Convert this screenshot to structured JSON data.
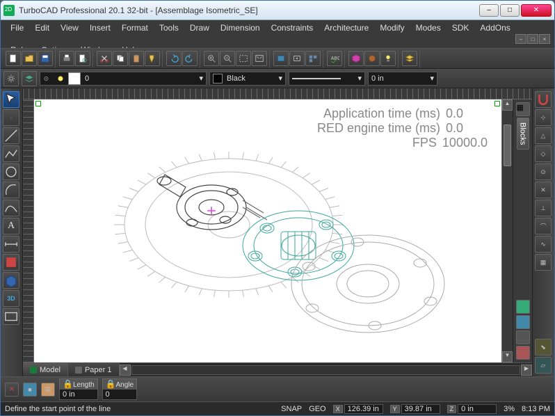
{
  "title": "TurboCAD Professional 20.1 32-bit - [Assemblage Isometric_SE]",
  "menus": [
    "File",
    "Edit",
    "View",
    "Insert",
    "Format",
    "Tools",
    "Draw",
    "Dimension",
    "Constraints",
    "Architecture",
    "Modify",
    "Modes",
    "SDK",
    "AddOns",
    "Ruby",
    "Options",
    "Window",
    "Help"
  ],
  "layer": {
    "value": "0"
  },
  "color": {
    "label": "Black"
  },
  "linewidth": {
    "value": "0 in"
  },
  "stats": {
    "app_time_label": "Application time (ms)",
    "app_time_value": "0.0",
    "red_time_label": "RED engine time (ms)",
    "red_time_value": "0.0",
    "fps_label": "FPS",
    "fps_value": "10000.0"
  },
  "tabs": {
    "model": "Model",
    "paper1": "Paper 1"
  },
  "palette_tab": "Blocks",
  "inspector": {
    "length_label": "Length",
    "length_value": "0 in",
    "angle_label": "Angle",
    "angle_value": "0"
  },
  "status": {
    "hint": "Define the start point of the line",
    "snap": "SNAP",
    "geo": "GEO",
    "x": "126.39 in",
    "y": "39.87 in",
    "z": "0 in",
    "zoom": "3%",
    "time": "8:13 PM"
  }
}
